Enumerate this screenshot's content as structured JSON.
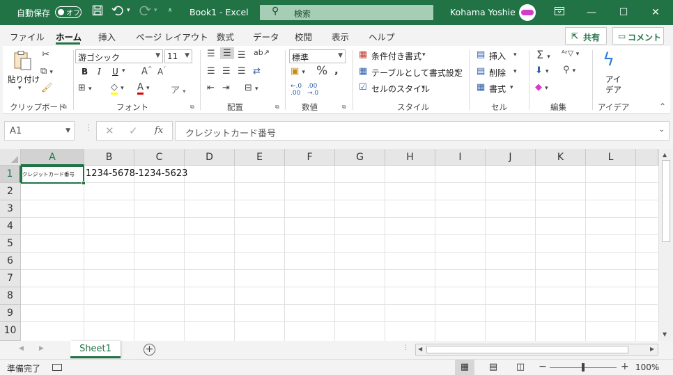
{
  "titlebar": {
    "autosave_label": "自動保存",
    "autosave_state": "オフ",
    "doc_title": "Book1  -  Excel",
    "search_placeholder": "検索",
    "user_name": "Kohama Yoshie",
    "accent_color": "#217346"
  },
  "tabs": {
    "items": [
      "ファイル",
      "ホーム",
      "挿入",
      "ページ レイアウト",
      "数式",
      "データ",
      "校閲",
      "表示",
      "ヘルプ"
    ],
    "active": "ホーム",
    "share": "共有",
    "comment": "コメント"
  },
  "ribbon": {
    "clipboard": {
      "paste": "貼り付け",
      "label": "クリップボード"
    },
    "font": {
      "name": "游ゴシック",
      "size": "11",
      "bold": "B",
      "italic": "I",
      "underline": "U",
      "label": "フォント"
    },
    "alignment": {
      "label": "配置"
    },
    "number": {
      "format": "標準",
      "label": "数値"
    },
    "styles": {
      "conditional": "条件付き書式",
      "table": "テーブルとして書式設定",
      "cell_styles": "セルのスタイル",
      "label": "スタイル"
    },
    "cells": {
      "insert": "挿入",
      "delete": "削除",
      "format": "書式",
      "label": "セル"
    },
    "editing": {
      "label": "編集"
    },
    "ideas": {
      "line1": "アイ",
      "line2": "デア",
      "label": "アイデア"
    }
  },
  "formula_bar": {
    "name_box": "A1",
    "fx": "fx",
    "content": "クレジットカード番号"
  },
  "grid": {
    "columns": [
      "A",
      "B",
      "C",
      "D",
      "E",
      "F",
      "G",
      "H",
      "I",
      "J",
      "K",
      "L"
    ],
    "rows": [
      "1",
      "2",
      "3",
      "4",
      "5",
      "6",
      "7",
      "8",
      "9",
      "10"
    ],
    "selected": "A1",
    "cells": {
      "A1": "クレジットカード番号",
      "B1": "1234-5678-1234-5623"
    }
  },
  "sheets": {
    "tabs": [
      "Sheet1"
    ],
    "active": "Sheet1"
  },
  "status": {
    "ready": "準備完了",
    "zoom": "100%"
  }
}
